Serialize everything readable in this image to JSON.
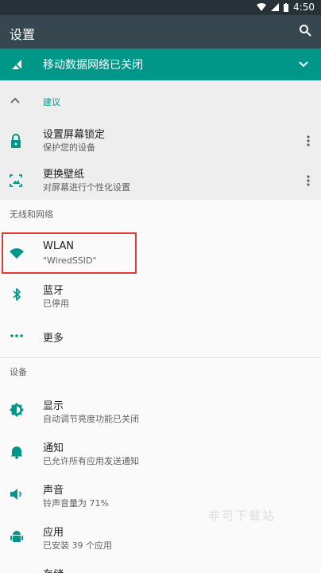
{
  "status_bar": {
    "time": "4:50"
  },
  "toolbar": {
    "title": "设置"
  },
  "banner": {
    "text": "移动数据网络已关闭"
  },
  "suggestions": {
    "header": "建议",
    "items": [
      {
        "title": "设置屏幕锁定",
        "subtitle": "保护您的设备"
      },
      {
        "title": "更换壁纸",
        "subtitle": "对屏幕进行个性化设置"
      }
    ]
  },
  "wireless_section": {
    "title": "无线和网络",
    "items": [
      {
        "title": "WLAN",
        "subtitle": "\"WiredSSID\""
      },
      {
        "title": "蓝牙",
        "subtitle": "已停用"
      },
      {
        "title": "更多"
      }
    ]
  },
  "device_section": {
    "title": "设备",
    "items": [
      {
        "title": "显示",
        "subtitle": "自动调节亮度功能已关闭"
      },
      {
        "title": "通知",
        "subtitle": "已允许所有应用发送通知"
      },
      {
        "title": "声音",
        "subtitle": "铃声音量为 71%"
      },
      {
        "title": "应用",
        "subtitle": "已安装 39 个应用"
      },
      {
        "title": "存储"
      }
    ]
  },
  "watermark": "非可下载站",
  "colors": {
    "accent": "#009688",
    "toolbar": "#37474f",
    "statusbar": "#263238",
    "highlight": "#e53935"
  }
}
